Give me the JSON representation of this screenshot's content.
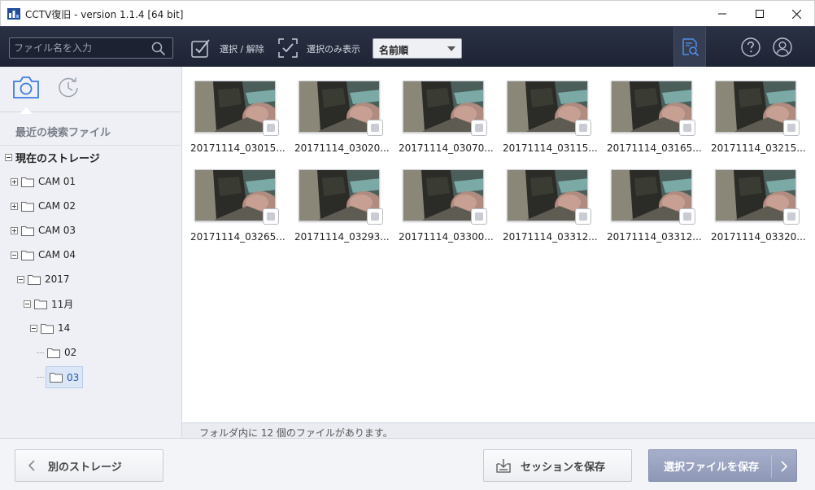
{
  "window": {
    "title": "CCTV復旧 - version 1.1.4 [64 bit]"
  },
  "toolbar": {
    "search_placeholder": "ファイル名を入力",
    "select_toggle_label": "選択 / 解除",
    "show_selected_label": "選択のみ表示",
    "sort_value": "名前順"
  },
  "sidebar": {
    "recent_label": "最近の検索ファイル",
    "storage_label": "現在のストレージ",
    "tree": [
      {
        "label": "CAM 01"
      },
      {
        "label": "CAM 02"
      },
      {
        "label": "CAM 03"
      },
      {
        "label": "CAM 04"
      },
      {
        "label": "2017"
      },
      {
        "label": "11月"
      },
      {
        "label": "14"
      },
      {
        "label": "02"
      },
      {
        "label": "03"
      }
    ]
  },
  "files": [
    {
      "name": "20171114_03015..."
    },
    {
      "name": "20171114_03020..."
    },
    {
      "name": "20171114_03070..."
    },
    {
      "name": "20171114_03115..."
    },
    {
      "name": "20171114_03165..."
    },
    {
      "name": "20171114_03215..."
    },
    {
      "name": "20171114_03265..."
    },
    {
      "name": "20171114_03293..."
    },
    {
      "name": "20171114_03300..."
    },
    {
      "name": "20171114_03312..."
    },
    {
      "name": "20171114_03312..."
    },
    {
      "name": "20171114_03320..."
    }
  ],
  "status": {
    "text": "フォルダ内に 12 個のファイルがあります。"
  },
  "footer": {
    "other_storage_label": "別のストレージ",
    "save_session_label": "セッションを保存",
    "save_selected_label": "選択ファイルを保存"
  },
  "colors": {
    "toolbar_bg": "#232a3b",
    "sidebar_bg": "#eef0f5",
    "accent": "#3d7de0",
    "primary_button": "#9aa3c0"
  }
}
